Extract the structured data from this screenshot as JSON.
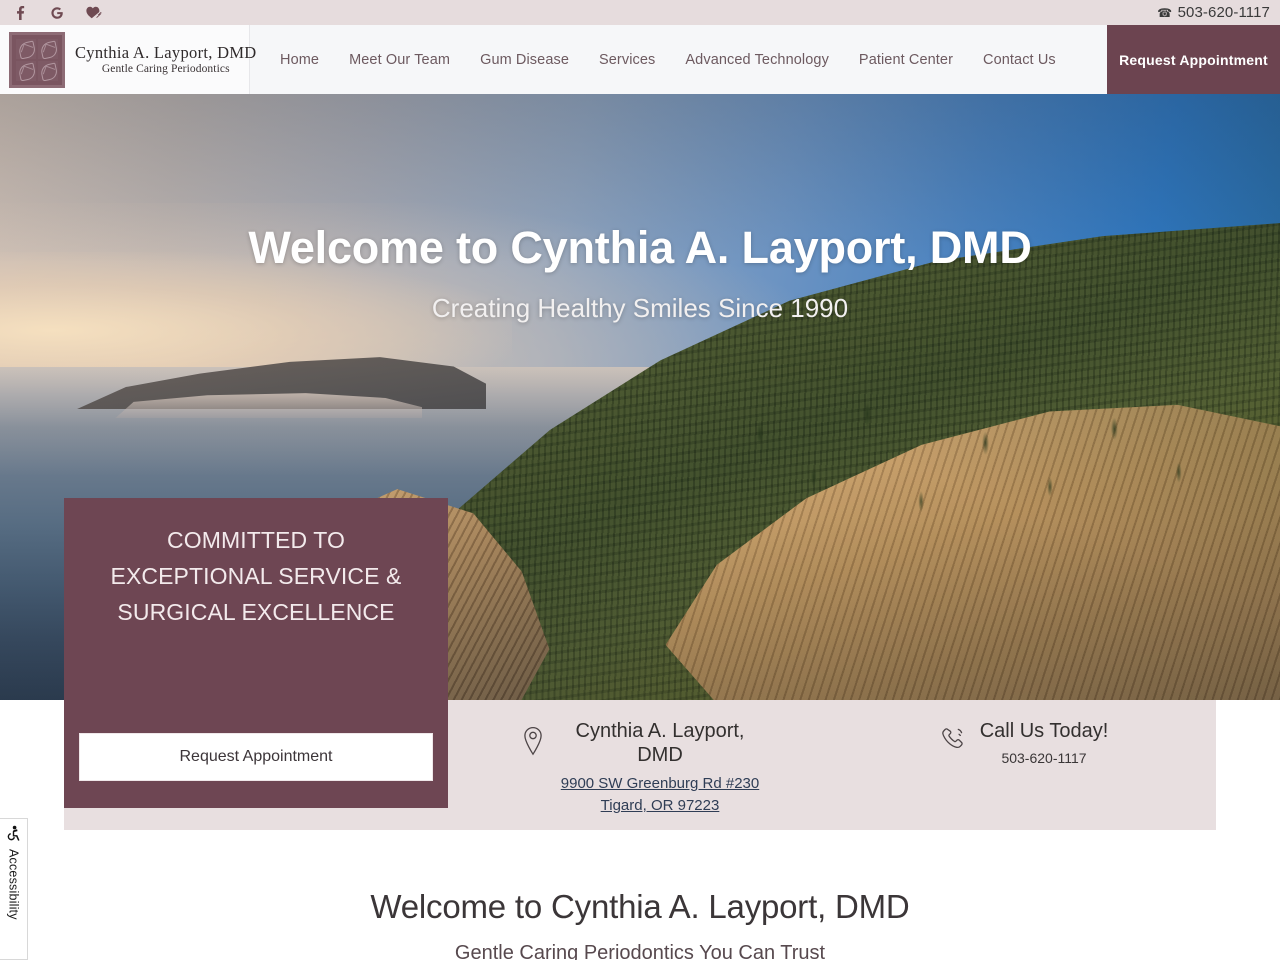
{
  "topbar": {
    "social": [
      {
        "name": "facebook-icon",
        "label": "Facebook"
      },
      {
        "name": "google-icon",
        "label": "Google"
      },
      {
        "name": "healthgrades-heart-icon",
        "label": "Healthgrades"
      }
    ],
    "phone_icon": "phone-icon",
    "phone": "503-620-1117"
  },
  "header": {
    "logo": {
      "icon": "window-leaf-logo-icon",
      "name": "Cynthia A. Layport, DMD",
      "tagline": "Gentle Caring Periodontics"
    },
    "nav": [
      {
        "label": "Home"
      },
      {
        "label": "Meet Our Team"
      },
      {
        "label": "Gum Disease"
      },
      {
        "label": "Services"
      },
      {
        "label": "Advanced Technology"
      },
      {
        "label": "Patient Center"
      },
      {
        "label": "Contact Us"
      }
    ],
    "cta_label": "Request Appointment"
  },
  "hero": {
    "title": "Welcome to Cynthia A. Layport, DMD",
    "subtitle": "Creating Healthy Smiles Since 1990",
    "background_alt": "Oregon coastline with forested cliffs at sunset"
  },
  "promo": {
    "headline_lines": [
      "COMMITTED TO",
      "EXCEPTIONAL SERVICE &",
      "SURGICAL EXCELLENCE"
    ],
    "button_label": "Request Appointment",
    "panel_color": "#6e4653"
  },
  "info": {
    "location": {
      "icon": "map-pin-icon",
      "title": "Cynthia A. Layport, DMD",
      "address_line1": "9900 SW Greenburg Rd #230",
      "address_line2": "Tigard, OR 97223"
    },
    "call": {
      "icon": "phone-ring-icon",
      "title": "Call Us Today!",
      "phone": "503-620-1117"
    },
    "background_color": "#e8dfe0"
  },
  "welcome": {
    "heading": "Welcome to Cynthia A. Layport, DMD",
    "subheading": "Gentle Caring Periodontics You Can Trust"
  },
  "accessibility": {
    "icon": "wheelchair-accessibility-icon",
    "label": "Accessibility"
  },
  "theme": {
    "accent_maroon": "#6c4450",
    "topbar_bg": "#e6dcdd",
    "header_bg": "#f6f7f9",
    "nav_text": "#6d5a60",
    "link_blue": "#2f3d55"
  }
}
